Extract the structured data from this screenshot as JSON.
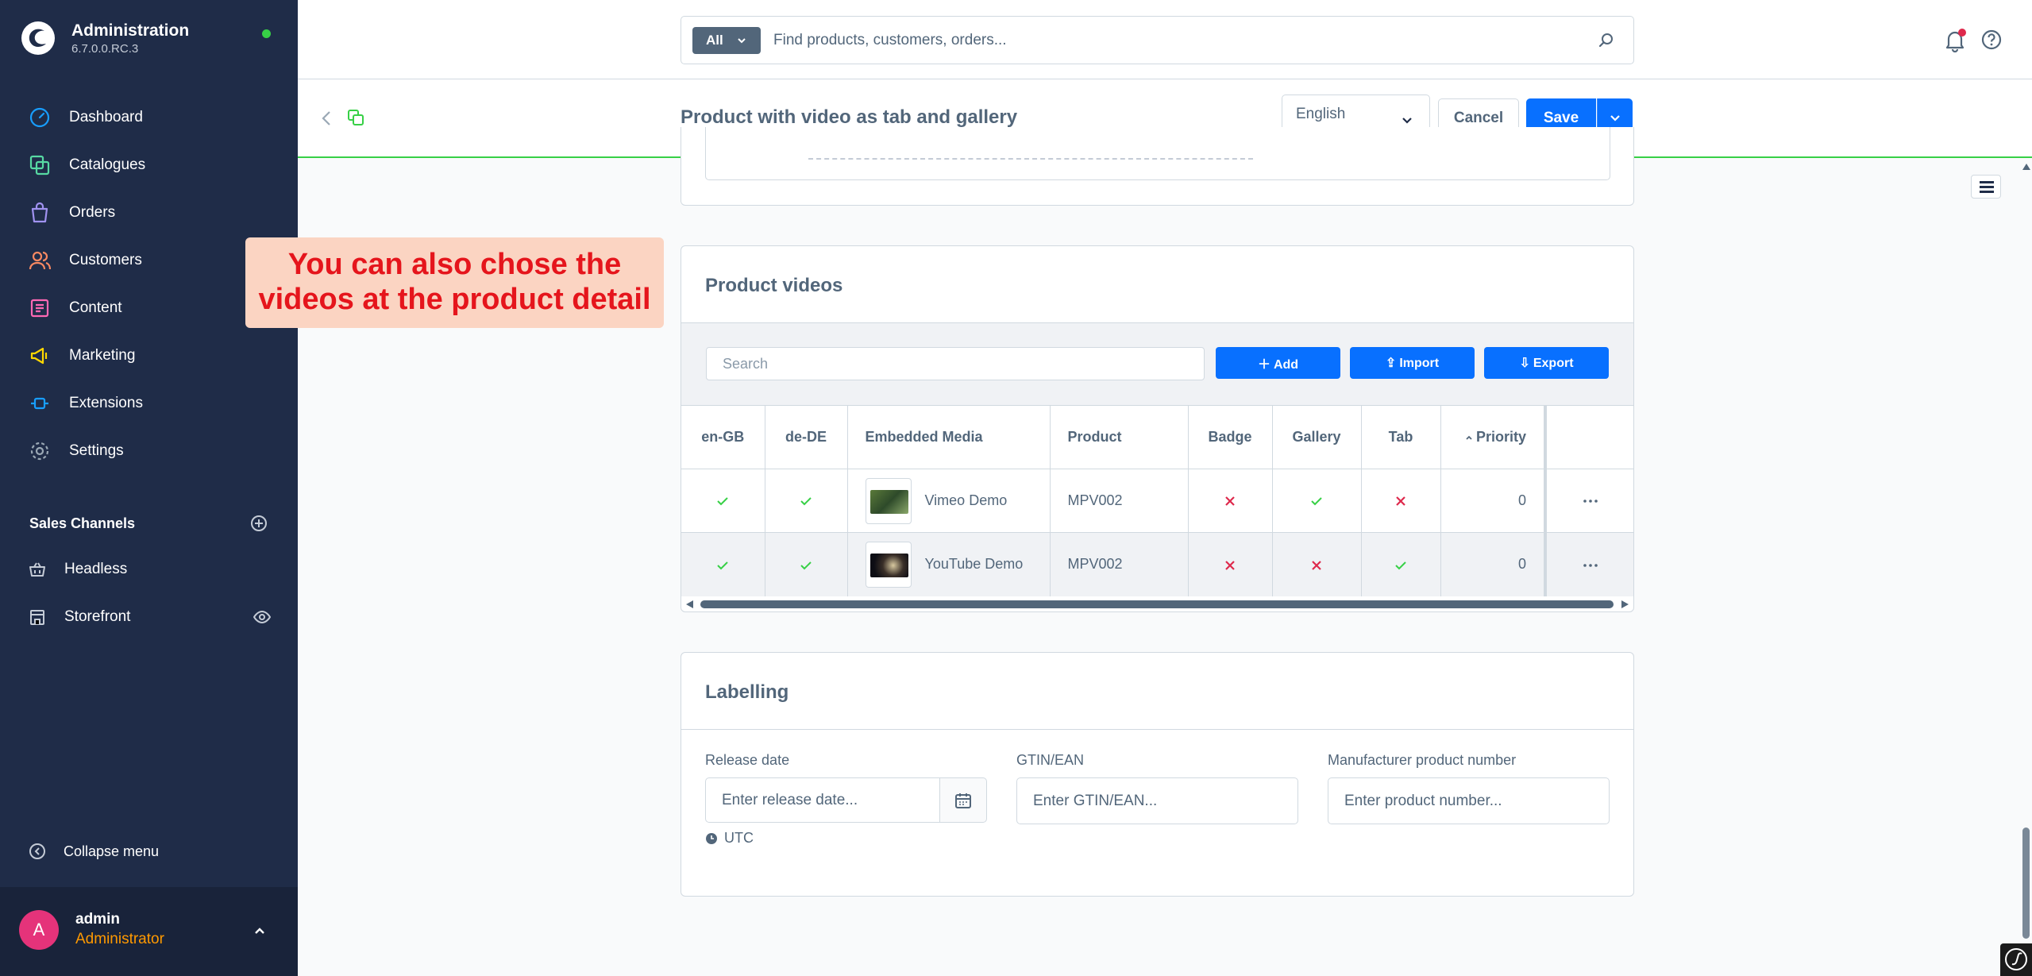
{
  "brand": {
    "title": "Administration",
    "version": "6.7.0.0.RC.3"
  },
  "nav": [
    {
      "label": "Dashboard",
      "icon": "dashboard-icon",
      "color": "#189eff"
    },
    {
      "label": "Catalogues",
      "icon": "catalogue-icon",
      "color": "#57d9a3"
    },
    {
      "label": "Orders",
      "icon": "orders-icon",
      "color": "#a092f0"
    },
    {
      "label": "Customers",
      "icon": "customers-icon",
      "color": "#f88962"
    },
    {
      "label": "Content",
      "icon": "content-icon",
      "color": "#ff68b4"
    },
    {
      "label": "Marketing",
      "icon": "marketing-icon",
      "color": "#ffd700"
    },
    {
      "label": "Extensions",
      "icon": "extensions-icon",
      "color": "#189eff"
    },
    {
      "label": "Settings",
      "icon": "settings-icon",
      "color": "#9aa8b5"
    }
  ],
  "sales_channels": {
    "title": "Sales Channels",
    "items": [
      {
        "label": "Headless",
        "icon": "basket-icon"
      },
      {
        "label": "Storefront",
        "icon": "storefront-icon"
      }
    ]
  },
  "collapse_label": "Collapse menu",
  "user": {
    "initial": "A",
    "name": "admin",
    "role": "Administrator"
  },
  "search": {
    "type": "All",
    "placeholder": "Find products, customers, orders..."
  },
  "smartbar": {
    "title": "Product with video as tab and gallery",
    "language": "English",
    "cancel": "Cancel",
    "save": "Save"
  },
  "callout": {
    "line1": "You can also chose the",
    "line2": "videos at the product detail"
  },
  "videos_card": {
    "title": "Product videos",
    "search_placeholder": "Search",
    "add": "Add",
    "import": "Import",
    "export": "Export",
    "columns": [
      "en-GB",
      "de-DE",
      "Embedded Media",
      "Product",
      "Badge",
      "Gallery",
      "Tab",
      "Priority"
    ],
    "rows": [
      {
        "en_gb": true,
        "de_de": true,
        "media": "Vimeo Demo",
        "product": "MPV002",
        "badge": false,
        "gallery": true,
        "tab": false,
        "priority": "0"
      },
      {
        "en_gb": true,
        "de_de": true,
        "media": "YouTube Demo",
        "product": "MPV002",
        "badge": false,
        "gallery": false,
        "tab": true,
        "priority": "0"
      }
    ]
  },
  "labelling_card": {
    "title": "Labelling",
    "release_date_label": "Release date",
    "release_date_placeholder": "Enter release date...",
    "timezone": "UTC",
    "gtin_label": "GTIN/EAN",
    "gtin_placeholder": "Enter GTIN/EAN...",
    "mpn_label": "Manufacturer product number",
    "mpn_placeholder": "Enter product number..."
  },
  "colors": {
    "sidebar": "#1f2c48",
    "primary": "#0870ff",
    "success": "#37d046",
    "danger": "#de294c",
    "callout_bg": "#fbd4c2",
    "callout_text": "#e5151c",
    "role": "#ff9900"
  }
}
